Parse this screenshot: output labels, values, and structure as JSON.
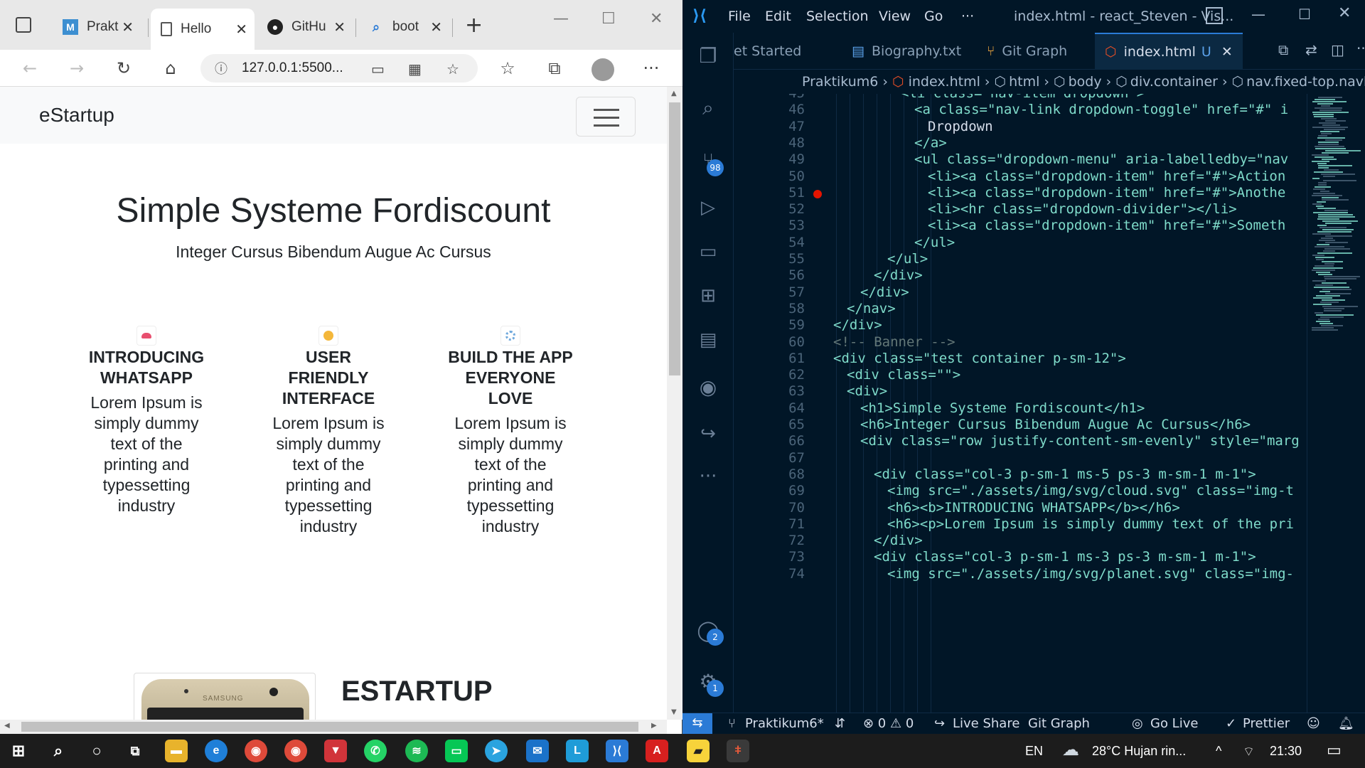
{
  "browser": {
    "tabs": [
      {
        "label": "Prakt",
        "icon": "m-icon"
      },
      {
        "label": "Hello",
        "icon": "page-icon"
      },
      {
        "label": "GitHu",
        "icon": "github-icon"
      },
      {
        "label": "boot",
        "icon": "search-icon"
      }
    ],
    "url": "127.0.0.1:5500...",
    "site": {
      "brand": "eStartup",
      "banner_title": "Simple Systeme Fordiscount",
      "banner_subtitle": "Integer Cursus Bibendum Augue Ac Cursus",
      "features": [
        {
          "title_lines": [
            "INTRODUCING",
            "WHATSAPP"
          ],
          "text_lines": [
            "Lorem Ipsum is",
            "simply dummy",
            "text of the",
            "printing and",
            "typessetting",
            "industry"
          ],
          "icon": "cloud-icon",
          "icon_color": "#e84f6f"
        },
        {
          "title_lines": [
            "USER",
            "FRIENDLY",
            "INTERFACE"
          ],
          "text_lines": [
            "Lorem Ipsum is",
            "simply dummy",
            "text of the",
            "printing and",
            "typessetting",
            "industry"
          ],
          "icon": "planet-icon",
          "icon_color": "#f4b73a"
        },
        {
          "title_lines": [
            "BUILD THE APP",
            "EVERYONE",
            "LOVE"
          ],
          "text_lines": [
            "Lorem Ipsum is",
            "simply dummy",
            "text of the",
            "printing and",
            "typessetting",
            "industry"
          ],
          "icon": "gear-icon",
          "icon_color": "#6fa8dc"
        }
      ],
      "section_heading": "ESTARTUP",
      "phone_brand": "SAMSUNG"
    }
  },
  "vscode": {
    "menu": [
      "File",
      "Edit",
      "Selection",
      "View",
      "Go",
      "···"
    ],
    "window_title": "index.html - react_Steven - Vis...",
    "tabs": [
      {
        "label": "et Started"
      },
      {
        "label": "Biography.txt"
      },
      {
        "label": "Git Graph"
      },
      {
        "label": "index.html",
        "status": "U"
      }
    ],
    "breadcrumb": [
      "Praktikum6",
      "index.html",
      "html",
      "body",
      "div.container",
      "nav.fixed-top.navbar.navb"
    ],
    "badges": {
      "source_control": "98",
      "accounts": "2",
      "settings": "1"
    },
    "code_lines": [
      {
        "n": "45",
        "indent": 5,
        "text": "<li class=\"nav-item dropdown\">"
      },
      {
        "n": "46",
        "indent": 6,
        "text": "<a class=\"nav-link dropdown-toggle\" href=\"#\" i"
      },
      {
        "n": "47",
        "indent": 7,
        "text": "Dropdown"
      },
      {
        "n": "48",
        "indent": 6,
        "text": "</a>"
      },
      {
        "n": "49",
        "indent": 6,
        "text": "<ul class=\"dropdown-menu\" aria-labelledby=\"nav"
      },
      {
        "n": "50",
        "indent": 7,
        "text": "<li><a class=\"dropdown-item\" href=\"#\">Action"
      },
      {
        "n": "51",
        "indent": 7,
        "text": "<li><a class=\"dropdown-item\" href=\"#\">Anothe"
      },
      {
        "n": "52",
        "indent": 7,
        "text": "<li><hr class=\"dropdown-divider\"></li>"
      },
      {
        "n": "53",
        "indent": 7,
        "text": "<li><a class=\"dropdown-item\" href=\"#\">Someth"
      },
      {
        "n": "54",
        "indent": 6,
        "text": "</ul>"
      },
      {
        "n": "55",
        "indent": 4,
        "text": "</ul>"
      },
      {
        "n": "56",
        "indent": 3,
        "text": "</div>"
      },
      {
        "n": "57",
        "indent": 2,
        "text": "</div>"
      },
      {
        "n": "58",
        "indent": 1,
        "text": "</nav>"
      },
      {
        "n": "59",
        "indent": 0,
        "text": "</div>"
      },
      {
        "n": "60",
        "indent": 0,
        "text": "<!-- Banner -->"
      },
      {
        "n": "61",
        "indent": 0,
        "text": "<div class=\"test container p-sm-12\">"
      },
      {
        "n": "62",
        "indent": 1,
        "text": "<div class=\"\">"
      },
      {
        "n": "63",
        "indent": 1,
        "text": "<div>"
      },
      {
        "n": "64",
        "indent": 2,
        "text": "<h1>Simple Systeme Fordiscount</h1>"
      },
      {
        "n": "65",
        "indent": 2,
        "text": "<h6>Integer Cursus Bibendum Augue Ac Cursus</h6>"
      },
      {
        "n": "66",
        "indent": 2,
        "text": "<div class=\"row justify-content-sm-evenly\" style=\"marg"
      },
      {
        "n": "67",
        "indent": 0,
        "text": ""
      },
      {
        "n": "68",
        "indent": 3,
        "text": "<div class=\"col-3 p-sm-1 ms-5 ps-3 m-sm-1 m-1\">"
      },
      {
        "n": "69",
        "indent": 4,
        "text": "<img src=\"./assets/img/svg/cloud.svg\" class=\"img-t"
      },
      {
        "n": "70",
        "indent": 4,
        "text": "<h6><b>INTRODUCING WHATSAPP</b></h6>"
      },
      {
        "n": "71",
        "indent": 4,
        "text": "<h6><p>Lorem Ipsum is simply dummy text of the pri"
      },
      {
        "n": "72",
        "indent": 3,
        "text": "</div>"
      },
      {
        "n": "73",
        "indent": 3,
        "text": "<div class=\"col-3 p-sm-1 ms-3 ps-3 m-sm-1 m-1\">"
      },
      {
        "n": "74",
        "indent": 4,
        "text": "<img src=\"./assets/img/svg/planet.svg\" class=\"img-"
      }
    ],
    "status": {
      "branch": "Praktikum6*",
      "problems": "⊗ 0 ⚠ 0",
      "live_share": "Live Share",
      "git_graph": "Git Graph",
      "go_live": "Go Live",
      "prettier": "Prettier"
    }
  },
  "taskbar": {
    "language": "EN",
    "weather": "28°C  Hujan rin...",
    "time": "21:30"
  },
  "colors": {
    "vscode_bg": "#011627",
    "code_tag": "#7fdbca",
    "code_attr": "#c5e478",
    "code_string": "#ecc48d",
    "code_comment": "#637777",
    "accent": "#2b7bd6"
  }
}
